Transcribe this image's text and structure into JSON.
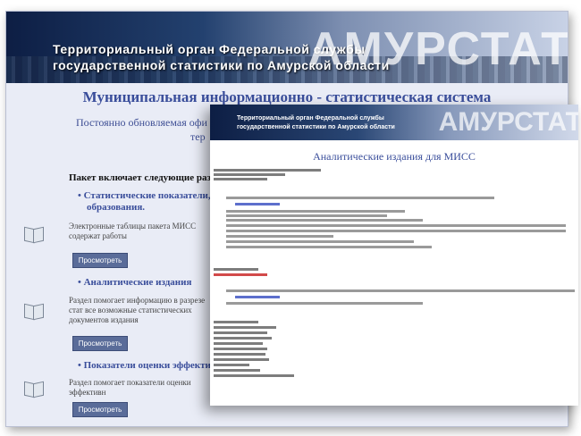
{
  "banner": {
    "line1": "Территориальный орган Федеральной службы",
    "line2": "государственной статистики по Амурской области",
    "logo": "АМУРСТАТ"
  },
  "page": {
    "title": "Муниципальная информационно - статистическая система",
    "subtitle_line1": "Постоянно обновляемая офи",
    "subtitle_line2": "тер",
    "intro": "Пакет включает следующие разделы:"
  },
  "sections": [
    {
      "title": "• Статистические показатели, хара",
      "title2": "образования.",
      "text": "Электронные таблицы пакета МИСС содержат работы",
      "button": "Просмотреть"
    },
    {
      "title": "• Аналитические издания",
      "text": "Раздел помогает информацию в разрезе стат все возможные статистических документов издания",
      "button": "Просмотреть"
    },
    {
      "title": "• Показатели оценки эффективност",
      "text": "Раздел помогает показатели оценки эффективн",
      "button": "Просмотреть"
    }
  ],
  "overlay": {
    "banner_line1": "Территориальный орган Федеральной службы",
    "banner_line2": "государственной статистики по Амурской области",
    "banner_logo": "АМУРСТАТ",
    "title": "Аналитические издания для МИСС"
  }
}
